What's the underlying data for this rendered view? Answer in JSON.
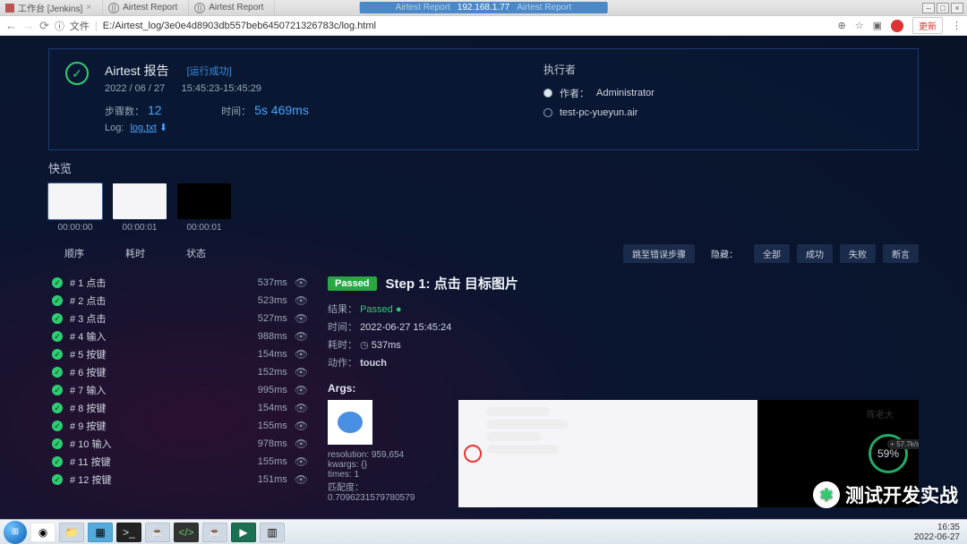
{
  "titlebar": {
    "tabs": [
      "工作台 [Jenkins]",
      "Airtest Report",
      "Airtest Report"
    ],
    "center_ip": "192.168.1.77",
    "center_left": "Airtest Report",
    "center_right": "Airtest Report"
  },
  "urlbar": {
    "prefix": "文件",
    "url": "E:/Airtest_log/3e0e4d8903db557beb6450721326783c/log.html",
    "update_btn": "更新"
  },
  "header": {
    "title": "Airtest 报告",
    "run_status": "[运行成功]",
    "date": "2022 / 06 / 27",
    "time_range": "15:45:23-15:45:29",
    "steps_label": "步骤数：",
    "steps_value": "12",
    "duration_label": "时间：",
    "duration_value": "5s 469ms",
    "log_label": "Log:",
    "log_file": "log.txt",
    "executor_label": "执行者",
    "author_label": "作者：",
    "author": "Administrator",
    "device": "test-pc-yueyun.air"
  },
  "quick": {
    "title": "快览",
    "thumbs": [
      "00:00:00",
      "00:00:01",
      "00:00:01"
    ]
  },
  "controls": {
    "tabs": [
      "顺序",
      "耗时",
      "状态"
    ],
    "right": [
      "跳至错误步骤",
      "隐藏：",
      "全部",
      "成功",
      "失败",
      "断言"
    ]
  },
  "steps": [
    {
      "name": "# 1  点击",
      "time": "537ms"
    },
    {
      "name": "# 2  点击",
      "time": "523ms"
    },
    {
      "name": "# 3  点击",
      "time": "527ms"
    },
    {
      "name": "# 4  输入",
      "time": "988ms"
    },
    {
      "name": "# 5  按键",
      "time": "154ms"
    },
    {
      "name": "# 6  按键",
      "time": "152ms"
    },
    {
      "name": "# 7  输入",
      "time": "995ms"
    },
    {
      "name": "# 8  按键",
      "time": "154ms"
    },
    {
      "name": "# 9  按键",
      "time": "155ms"
    },
    {
      "name": "# 10  输入",
      "time": "978ms"
    },
    {
      "name": "# 11  按键",
      "time": "155ms"
    },
    {
      "name": "# 12  按键",
      "time": "151ms"
    }
  ],
  "detail": {
    "badge": "Passed",
    "title": "Step 1: 点击 目标图片",
    "result_label": "结果：",
    "result_value": "Passed",
    "time_label": "时间：",
    "time_value": "2022-06-27 15:45:24",
    "duration_label": "耗时：",
    "duration_value": "537ms",
    "action_label": "动作：",
    "action_value": "touch",
    "args_label": "Args:",
    "resolution": "resolution: 959,654",
    "kwargs": "kwargs: {}",
    "times": "times: 1",
    "confidence": "匹配度：  0.7096231579780579",
    "chat_name": "陈老大",
    "gauge": "59%",
    "gauge_side": "+ 57.7k/s"
  },
  "watermark": "测试开发实战",
  "taskbar": {
    "clock_time": "16:35",
    "clock_date": "2022-06-27"
  }
}
